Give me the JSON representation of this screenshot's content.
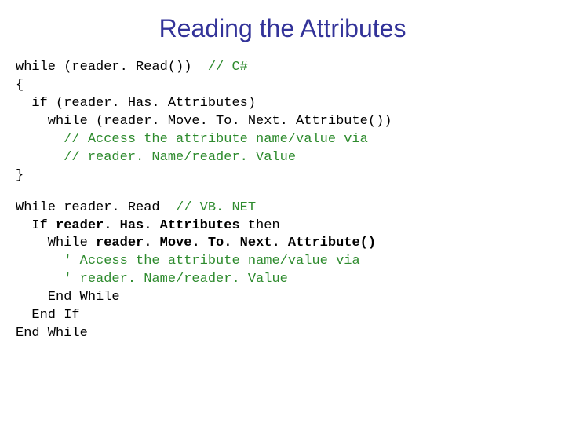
{
  "title": "Reading the Attributes",
  "csharp": {
    "l1a": "while (reader. Read())  ",
    "l1b": "// C#",
    "l2": "{",
    "l3": "  if (reader. Has. Attributes)",
    "l4": "    while (reader. Move. To. Next. Attribute())",
    "l5": "      // Access the attribute name/value via",
    "l6": "      // reader. Name/reader. Value",
    "l7": "}"
  },
  "vbnet": {
    "l1a": "While reader. Read  ",
    "l1b": "// VB. NET",
    "l2a": "  If ",
    "l2b": "reader. Has. Attributes",
    "l2c": " then",
    "l3a": "    While ",
    "l3b": "reader. Move. To. Next. Attribute()",
    "l4": "      ' Access the attribute name/value via",
    "l5": "      ' reader. Name/reader. Value",
    "l6": "    End While",
    "l7": "  End If",
    "l8": "End While"
  }
}
